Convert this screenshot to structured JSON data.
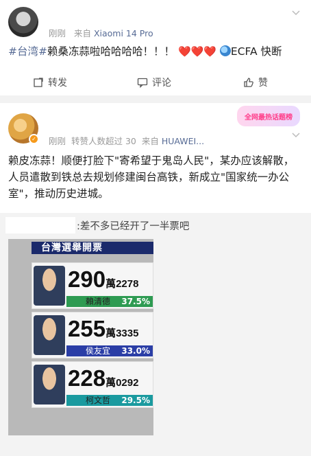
{
  "post1": {
    "meta_time": "刚刚",
    "meta_source": "来自",
    "meta_device": "Xiaomi 14 Pro",
    "tag": "#台湾#",
    "text": "赖桑冻蒜啦哈哈哈哈！！！",
    "hearts": "❤️❤️❤️",
    "tail": "ECFA 快断",
    "actions": {
      "repost": "转发",
      "comment": "评论",
      "like": "赞"
    }
  },
  "post2": {
    "meta_time": "刚刚",
    "meta_count": "转赞人数超过 30",
    "meta_source": "来自",
    "meta_device": "HUAWEI...",
    "promo": "全网最热话题榜",
    "text": "赖皮冻蒜！顺便打脸下\"寄希望于鬼岛人民\"，某办应该解散，人员遣散到铁总去规划修建闽台高铁，新成立\"国家统一办公室\"，推动历史进城。",
    "repost_text": "差不多已经开了一半票吧"
  },
  "tv": {
    "header": "台灣選舉開票",
    "candidates": [
      {
        "big": "290",
        "unit": "萬",
        "small": "2278",
        "name": "賴清德",
        "pct": "37.5%",
        "color": "#2e9b52"
      },
      {
        "big": "255",
        "unit": "萬",
        "small": "3335",
        "name": "侯友宜",
        "pct": "33.0%",
        "color": "#2b3ea6"
      },
      {
        "big": "228",
        "unit": "萬",
        "small": "0292",
        "name": "柯文哲",
        "pct": "29.5%",
        "color": "#1a9a9f"
      }
    ]
  }
}
